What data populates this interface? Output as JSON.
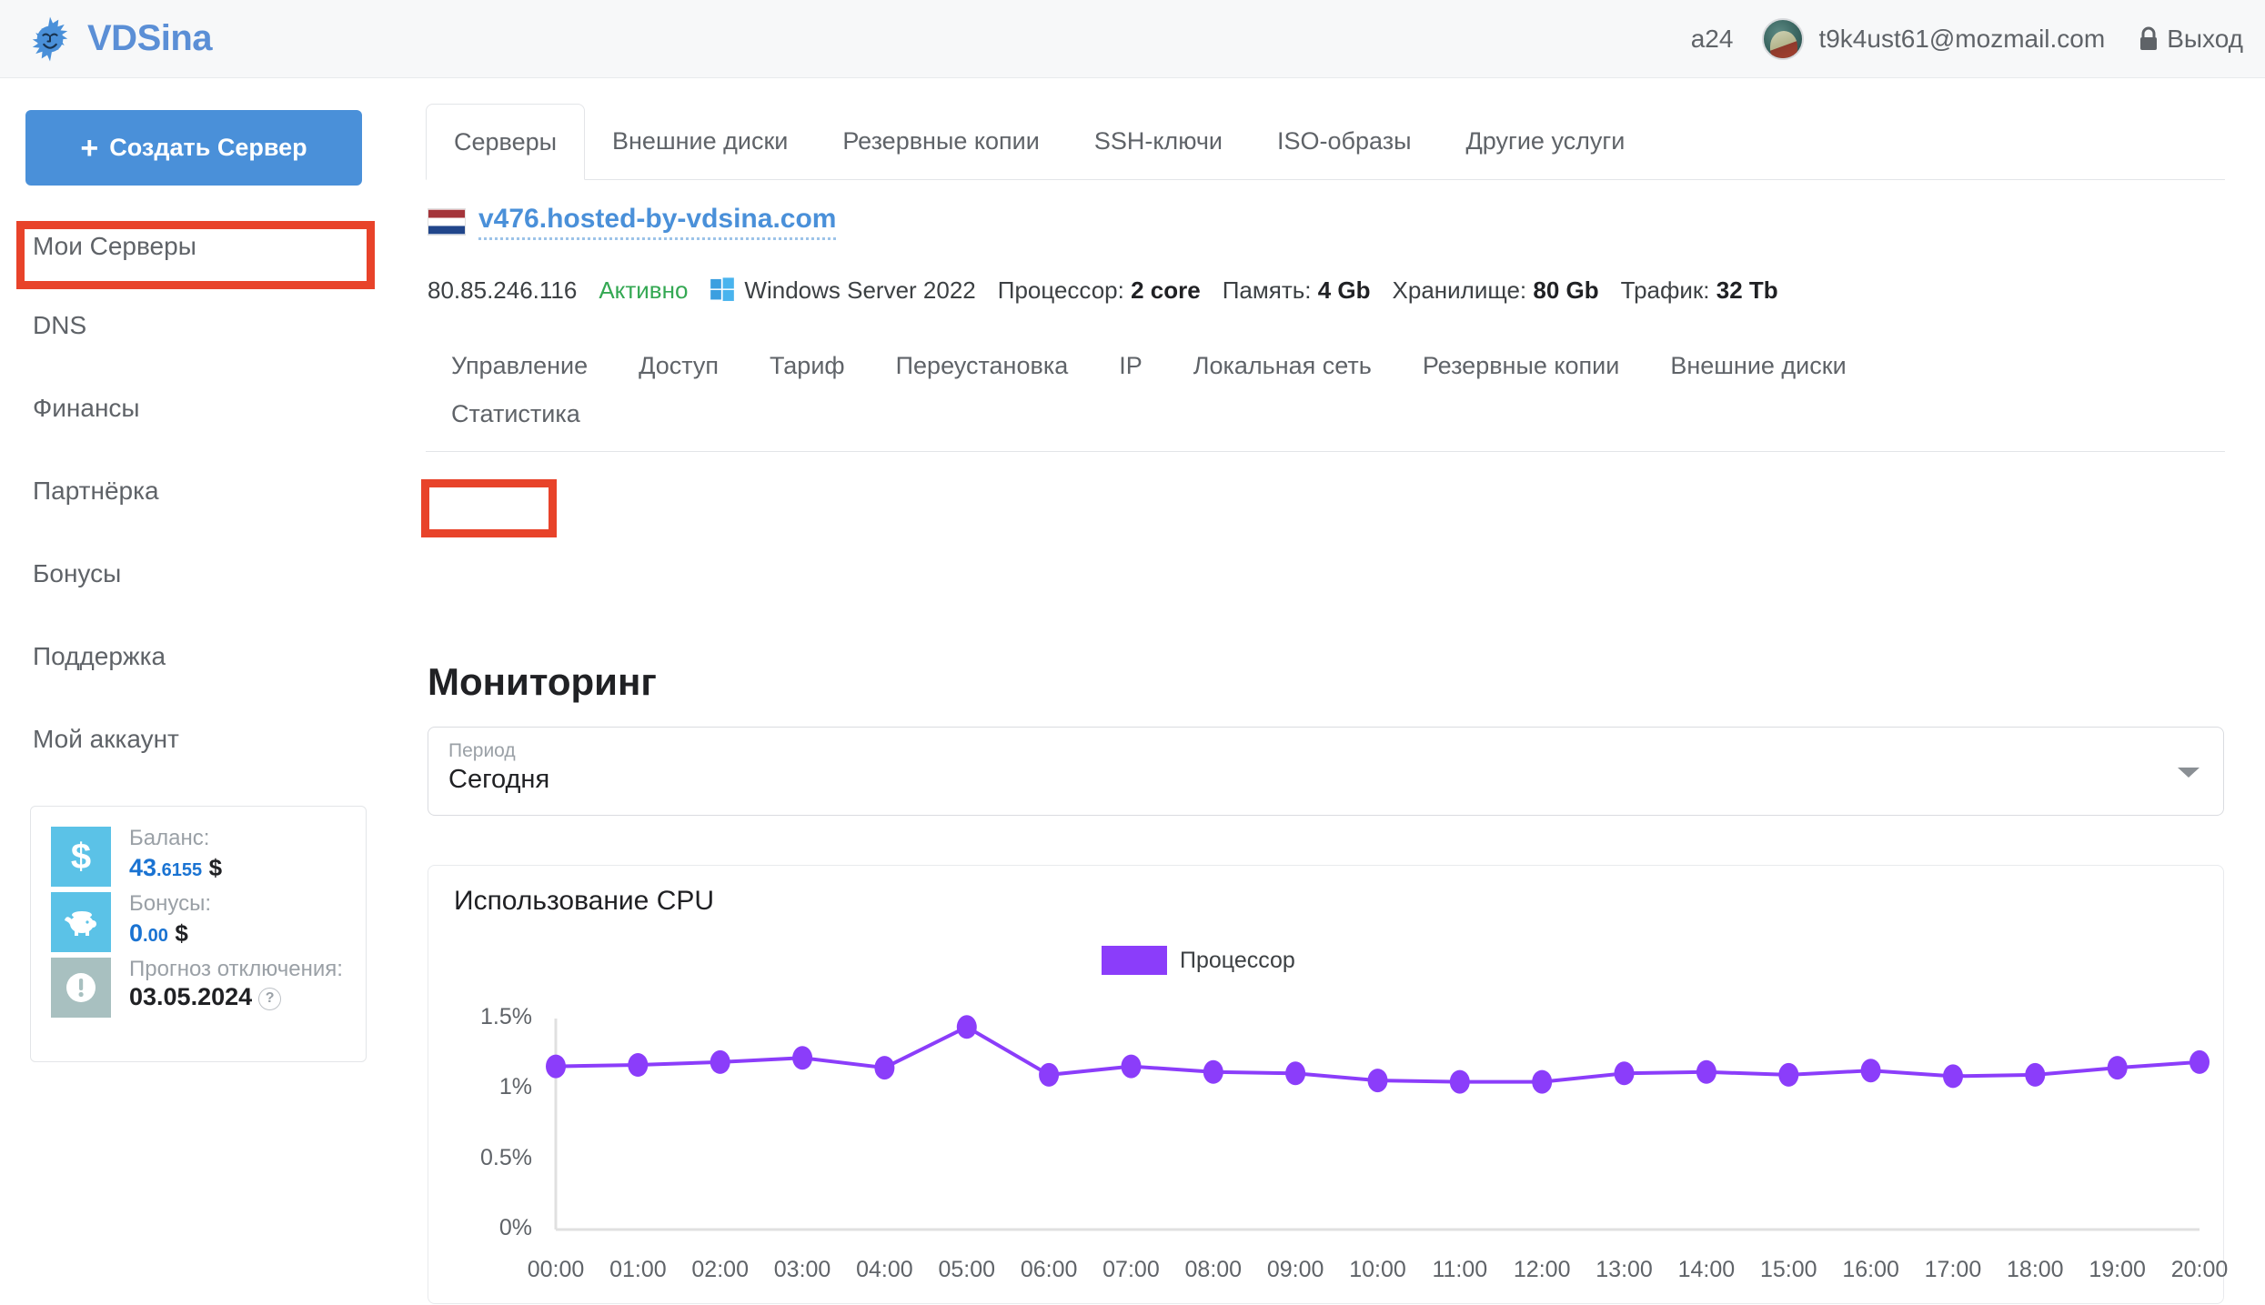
{
  "header": {
    "logo_text": "VDSina",
    "logo_icon": "sun-icon",
    "account_label": "a24",
    "email": "t9k4ust61@mozmail.com",
    "logout_label": "Выход",
    "logout_icon": "lock-icon",
    "avatar_icon": "avatar"
  },
  "sidebar": {
    "create_button": "Создать Сервер",
    "create_icon": "plus-icon",
    "items": [
      {
        "label": "Мои Серверы"
      },
      {
        "label": "DNS"
      },
      {
        "label": "Финансы"
      },
      {
        "label": "Партнёрка"
      },
      {
        "label": "Бонусы"
      },
      {
        "label": "Поддержка"
      },
      {
        "label": "Мой аккаунт"
      }
    ],
    "balance_card": {
      "balance_label": "Баланс:",
      "balance_int": "43",
      "balance_frac": ".6155",
      "balance_currency": "$",
      "bonus_label": "Бонусы:",
      "bonus_int": "0",
      "bonus_frac": ".00",
      "bonus_currency": "$",
      "forecast_label": "Прогноз отключения:",
      "forecast_value": "03.05.2024",
      "help_glyph": "?",
      "dollar_icon": "dollar-icon",
      "piggy_icon": "piggy-bank-icon",
      "warning_icon": "exclamation-icon"
    }
  },
  "main": {
    "top_tabs": [
      {
        "label": "Серверы",
        "active": true
      },
      {
        "label": "Внешние диски",
        "active": false
      },
      {
        "label": "Резервные копии",
        "active": false
      },
      {
        "label": "SSH-ключи",
        "active": false
      },
      {
        "label": "ISO-образы",
        "active": false
      },
      {
        "label": "Другие услуги",
        "active": false
      }
    ],
    "server": {
      "flag_icon": "netherlands-flag-icon",
      "hostname": "v476.hosted-by-vdsina.com",
      "ip": "80.85.246.116",
      "status": "Активно",
      "os_icon": "windows-icon",
      "os": "Windows Server 2022",
      "cpu_label": "Процессор:",
      "cpu_value": "2 core",
      "ram_label": "Память:",
      "ram_value": "4 Gb",
      "storage_label": "Хранилище:",
      "storage_value": "80 Gb",
      "traffic_label": "Трафик:",
      "traffic_value": "32 Tb"
    },
    "sub_tabs": [
      {
        "label": "Управление"
      },
      {
        "label": "Доступ"
      },
      {
        "label": "Тариф"
      },
      {
        "label": "Переустановка"
      },
      {
        "label": "IP"
      },
      {
        "label": "Локальная сеть"
      },
      {
        "label": "Резервные копии"
      },
      {
        "label": "Внешние диски"
      }
    ],
    "sub_tabs_row2": [
      {
        "label": "Статистика"
      }
    ],
    "monitoring_title": "Мониторинг",
    "period": {
      "label": "Период",
      "value": "Сегодня",
      "caret_icon": "chevron-down-icon"
    }
  },
  "annotations": {
    "highlight_color": "#e8432a",
    "targets": [
      "Мои Серверы",
      "Статистика"
    ]
  },
  "chart_data": {
    "type": "line",
    "title": "Использование CPU",
    "xlabel": "",
    "ylabel": "",
    "ylim": [
      0,
      1.5
    ],
    "yticks": [
      0,
      0.5,
      1,
      1.5
    ],
    "ytick_labels": [
      "0%",
      "0.5%",
      "1%",
      "1.5%"
    ],
    "grid": false,
    "legend_position": "top-center",
    "series": [
      {
        "name": "Процессор",
        "color": "#8b3dfa",
        "values": [
          1.16,
          1.17,
          1.19,
          1.22,
          1.15,
          1.44,
          1.1,
          1.16,
          1.12,
          1.11,
          1.06,
          1.05,
          1.05,
          1.11,
          1.12,
          1.1,
          1.13,
          1.09,
          1.1,
          1.15,
          1.19
        ]
      }
    ],
    "categories": [
      "00:00",
      "01:00",
      "02:00",
      "03:00",
      "04:00",
      "05:00",
      "06:00",
      "07:00",
      "08:00",
      "09:00",
      "10:00",
      "11:00",
      "12:00",
      "13:00",
      "14:00",
      "15:00",
      "16:00",
      "17:00",
      "18:00",
      "19:00",
      "20:00"
    ]
  }
}
